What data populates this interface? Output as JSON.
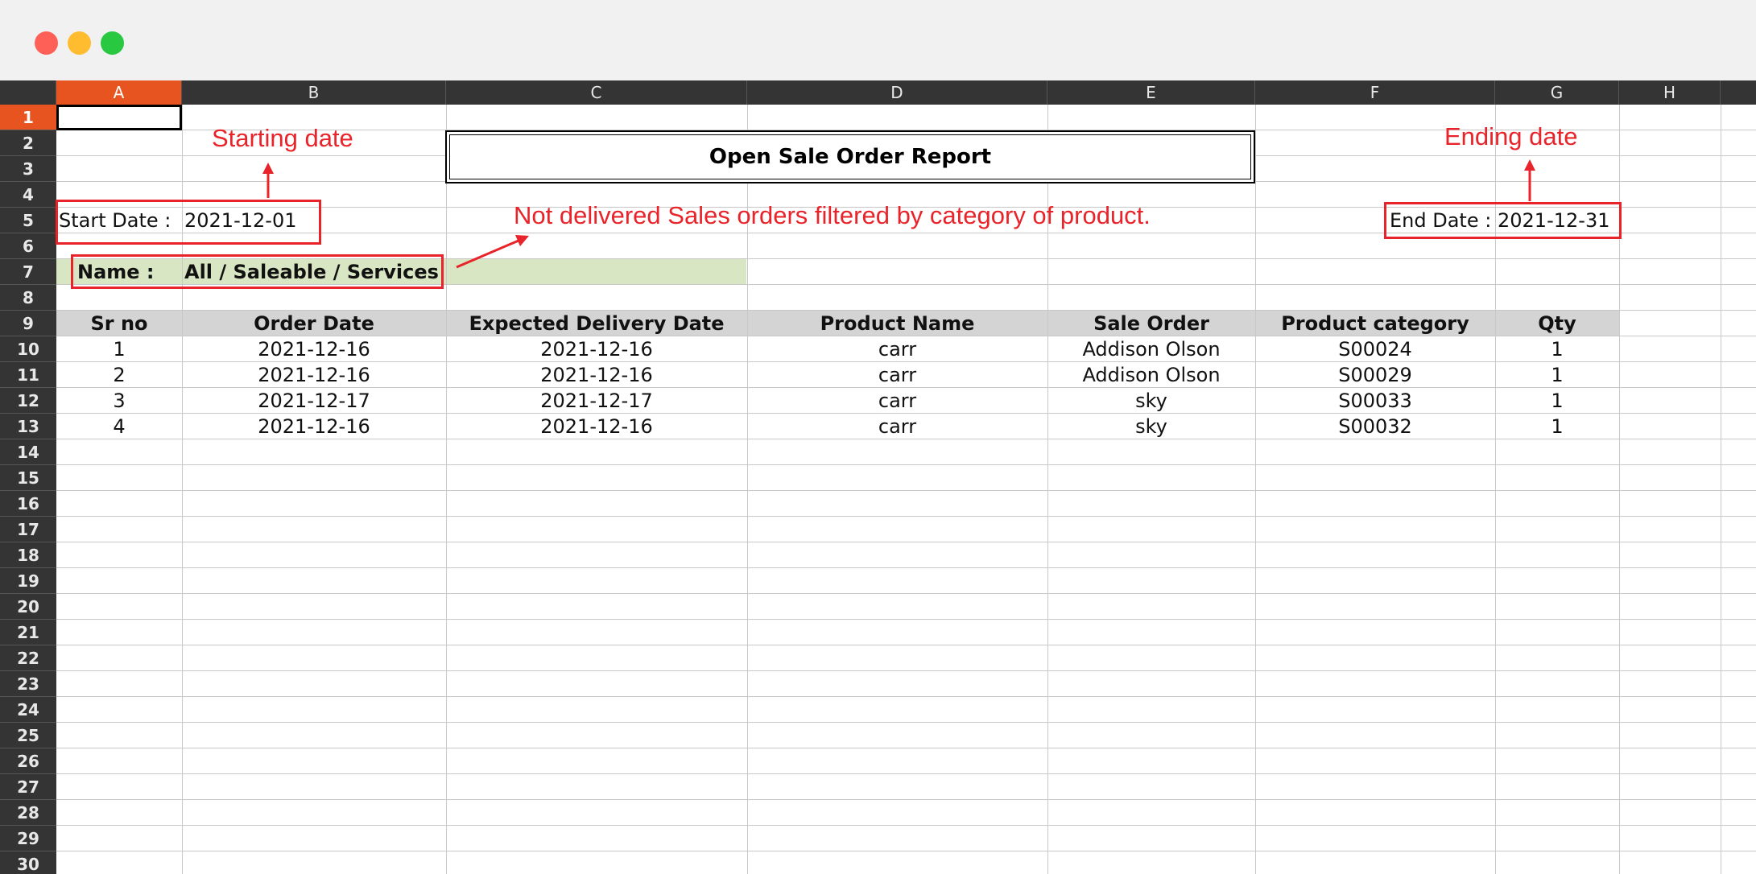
{
  "window": {
    "controls": [
      "close",
      "minimize",
      "maximize"
    ]
  },
  "sheet": {
    "columns": [
      "A",
      "B",
      "C",
      "D",
      "E",
      "F",
      "G",
      "H"
    ],
    "rows": [
      "1",
      "2",
      "3",
      "4",
      "5",
      "6",
      "7",
      "8",
      "9",
      "10",
      "11",
      "12",
      "13",
      "14",
      "15",
      "16",
      "17",
      "18",
      "19",
      "20",
      "21",
      "22",
      "23",
      "24",
      "25",
      "26",
      "27",
      "28",
      "29",
      "30"
    ],
    "selected_cell": "A1"
  },
  "report": {
    "title": "Open Sale Order Report",
    "start_label": "Start Date :",
    "start_value": "2021-12-01",
    "end_label": "End Date :",
    "end_value": "2021-12-31",
    "name_label": "Name :",
    "name_value": "All / Saleable / Services",
    "headers": [
      "Sr no",
      "Order Date",
      "Expected Delivery Date",
      "Product Name",
      "Sale Order",
      "Product category",
      "Qty"
    ],
    "rows": [
      [
        "1",
        "2021-12-16",
        "2021-12-16",
        "carr",
        "Addison Olson",
        "S00024",
        "1"
      ],
      [
        "2",
        "2021-12-16",
        "2021-12-16",
        "carr",
        "Addison Olson",
        "S00029",
        "1"
      ],
      [
        "3",
        "2021-12-17",
        "2021-12-17",
        "carr",
        "sky",
        "S00033",
        "1"
      ],
      [
        "4",
        "2021-12-16",
        "2021-12-16",
        "carr",
        "sky",
        "S00032",
        "1"
      ]
    ]
  },
  "annotations": {
    "starting_date": "Starting date",
    "ending_date": "Ending date",
    "filter_note": "Not delivered Sales orders filtered by category of product."
  },
  "colors": {
    "annotation_red": "#e8242a",
    "selected_header": "#e75420",
    "name_fill": "#d9e6c3",
    "header_band": "#d4d4d4"
  }
}
